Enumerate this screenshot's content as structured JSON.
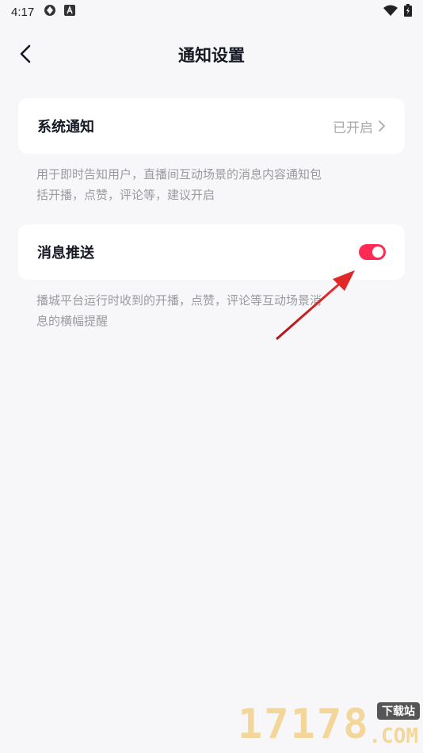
{
  "status_bar": {
    "time": "4:17",
    "left_icons": [
      "app-icon",
      "a-icon"
    ],
    "right_icons": [
      "wifi-icon",
      "battery-icon"
    ]
  },
  "header": {
    "title": "通知设置",
    "back_icon": "chevron-left-icon"
  },
  "settings": {
    "system_notification": {
      "label": "系统通知",
      "value": "已开启",
      "description": "用于即时告知用户，直播间互动场景的消息内容通知包括开播，点赞，评论等，建议开启"
    },
    "push_notification": {
      "label": "消息推送",
      "enabled": true,
      "description": "播城平台运行时收到的开播，点赞，评论等互动场景消息的横幅提醒"
    }
  },
  "watermark": {
    "number": "17178",
    "badge": "下载站",
    "suffix": ".COM"
  },
  "colors": {
    "accent": "#fe2c55",
    "background": "#f7f7f9",
    "card": "#ffffff",
    "annotation_arrow": "#d21e1e"
  }
}
